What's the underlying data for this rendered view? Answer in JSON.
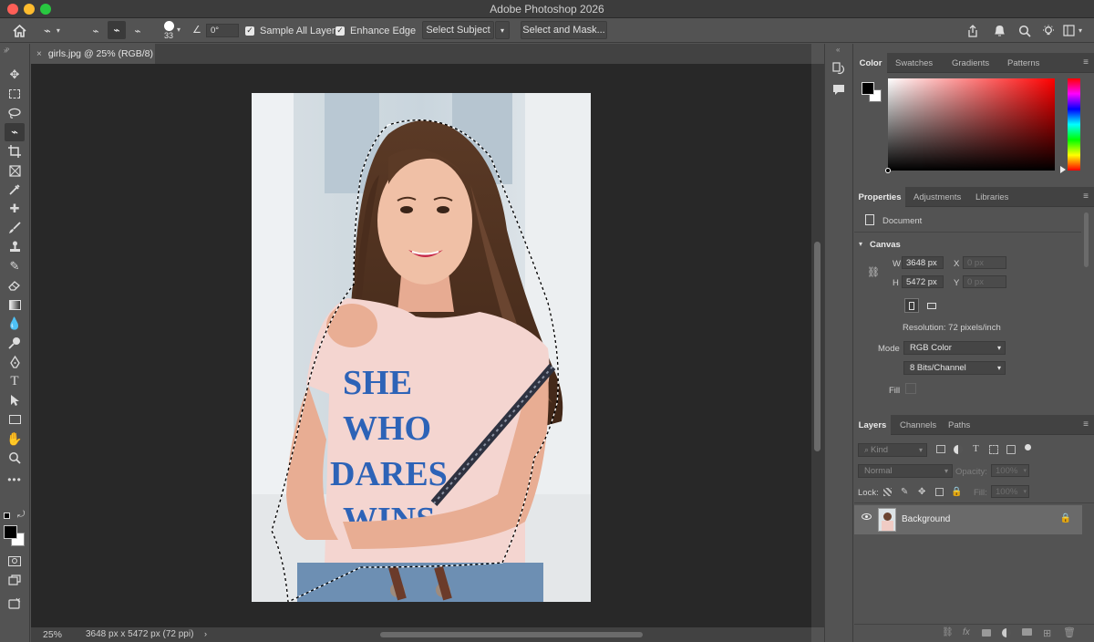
{
  "window": {
    "title": "Adobe Photoshop 2026"
  },
  "options_bar": {
    "brush_size": "33",
    "angle": "0°",
    "sample_all_layers": "Sample All Layers",
    "enhance_edge": "Enhance Edge",
    "select_subject": "Select Subject",
    "select_and_mask": "Select and Mask..."
  },
  "document": {
    "tab_label": "girls.jpg @ 25% (RGB/8)",
    "zoom": "25%",
    "info": "3648 px x 5472 px (72 ppi)",
    "shirt_lines": [
      "SHE",
      "WHO",
      "DARES",
      "WINS"
    ]
  },
  "color_panel": {
    "tabs": [
      "Color",
      "Swatches",
      "Gradients",
      "Patterns"
    ],
    "foreground": "#000000",
    "background": "#ffffff",
    "hue_color": "#ff0000"
  },
  "properties": {
    "tabs": [
      "Properties",
      "Adjustments",
      "Libraries"
    ],
    "doc_label": "Document",
    "section": "Canvas",
    "w_label": "W",
    "w_value": "3648 px",
    "h_label": "H",
    "h_value": "5472 px",
    "x_label": "X",
    "x_value": "0 px",
    "y_label": "Y",
    "y_value": "0 px",
    "resolution": "Resolution: 72 pixels/inch",
    "mode_label": "Mode",
    "mode_value": "RGB Color",
    "bits_value": "8 Bits/Channel",
    "fill_label": "Fill"
  },
  "layers": {
    "tabs": [
      "Layers",
      "Channels",
      "Paths"
    ],
    "kind_placeholder": "Kind",
    "blend_mode": "Normal",
    "opacity_label": "Opacity:",
    "opacity_value": "100%",
    "lock_label": "Lock:",
    "fill_label": "Fill:",
    "fill_value": "100%",
    "layer_name": "Background"
  }
}
